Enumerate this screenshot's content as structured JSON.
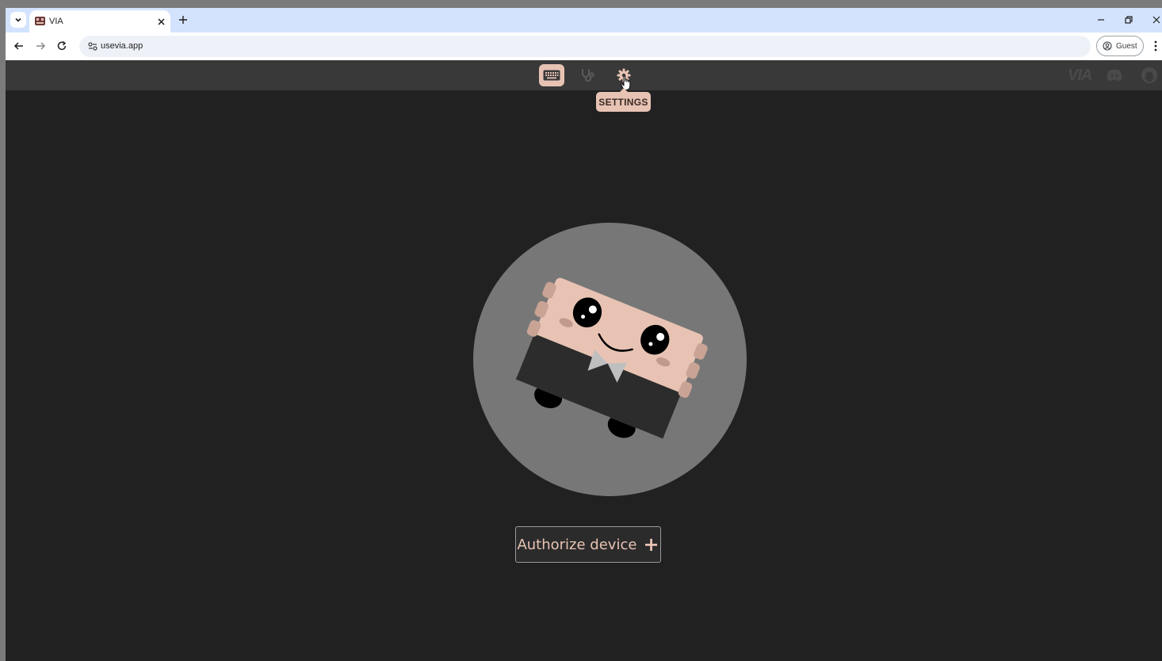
{
  "browser": {
    "tab_title": "VIA",
    "url": "usevia.app",
    "profile_label": "Guest"
  },
  "app": {
    "nav": [
      {
        "name": "configure",
        "icon": "keyboard-icon",
        "active": true
      },
      {
        "name": "test",
        "icon": "stethoscope-icon",
        "active": false
      },
      {
        "name": "settings",
        "icon": "gear-icon",
        "active": false
      }
    ],
    "tooltip": "SETTINGS",
    "logo": "VIA",
    "authorize_label": "Authorize device",
    "authorize_icon": "plus-icon"
  },
  "colors": {
    "accent": "#e8c3b4",
    "background": "#212121",
    "header": "#393939",
    "circle": "#777777"
  }
}
